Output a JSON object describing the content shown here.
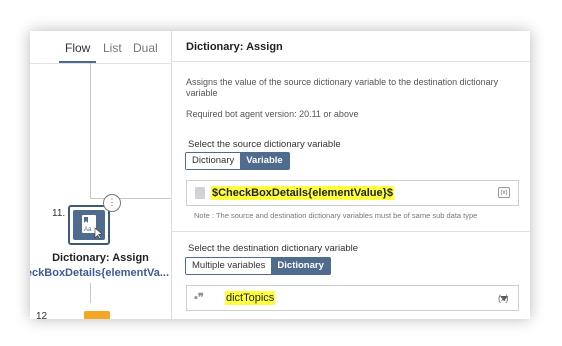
{
  "tabs": {
    "flow": "Flow",
    "list": "List",
    "dual": "Dual"
  },
  "canvas": {
    "step_11": "11.",
    "step_12": "12",
    "node_title": "Dictionary: Assign",
    "node_subtitle": "$CheckBoxDetails{elementValue}$",
    "node_subtitle_visible": "heckBoxDetails{elementVa..."
  },
  "panel": {
    "title": "Dictionary: Assign",
    "description": "Assigns the value of the source dictionary variable to the destination dictionary variable",
    "required_version": "Required bot agent version: 20.11 or above",
    "source_label": "Select the source dictionary variable",
    "source_options": [
      "Dictionary",
      "Variable"
    ],
    "source_value": "$CheckBoxDetails{elementValue}$",
    "source_note": "Note : The source and destination dictionary variables must be of same sub data type",
    "dest_label": "Select the destination dictionary variable",
    "dest_options": [
      "Multiple variables",
      "Dictionary"
    ],
    "dest_value": "dictTopics",
    "var_icon_text": "(x)"
  },
  "colors": {
    "accent": "#4f6c8f",
    "highlight": "#ffff3b",
    "step_next": "#f5a623"
  },
  "icons": {
    "node": "dictionary-assign-icon",
    "more": "more-options-icon",
    "source": "document-icon",
    "insert_var": "insert-variable-icon",
    "dest": "dictionary-quote-icon",
    "dropdown": "chevron-down-icon"
  }
}
